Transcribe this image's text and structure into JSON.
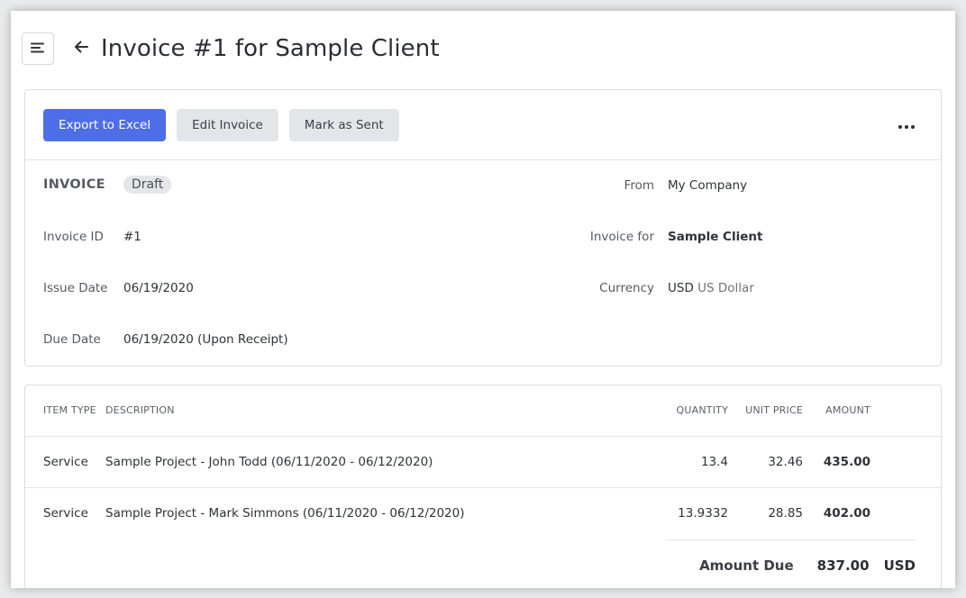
{
  "header": {
    "title": "Invoice #1 for Sample Client"
  },
  "toolbar": {
    "export_label": "Export to Excel",
    "edit_label": "Edit Invoice",
    "mark_sent_label": "Mark as Sent"
  },
  "invoice": {
    "heading": "INVOICE",
    "status": "Draft",
    "id_label": "Invoice ID",
    "id_value": "#1",
    "issue_label": "Issue Date",
    "issue_value": "06/19/2020",
    "due_label": "Due Date",
    "due_value": "06/19/2020 (Upon Receipt)",
    "from_label": "From",
    "from_value": "My Company",
    "for_label": "Invoice for",
    "for_value": "Sample Client",
    "currency_label": "Currency",
    "currency_code": "USD",
    "currency_name": "US Dollar"
  },
  "items_table": {
    "columns": {
      "item_type": "ITEM TYPE",
      "description": "DESCRIPTION",
      "quantity": "QUANTITY",
      "unit_price": "UNIT PRICE",
      "amount": "AMOUNT"
    },
    "rows": [
      {
        "item_type": "Service",
        "description": "Sample Project - John Todd (06/11/2020 - 06/12/2020)",
        "quantity": "13.4",
        "unit_price": "32.46",
        "amount": "435.00"
      },
      {
        "item_type": "Service",
        "description": "Sample Project - Mark Simmons (06/11/2020 - 06/12/2020)",
        "quantity": "13.9332",
        "unit_price": "28.85",
        "amount": "402.00"
      }
    ],
    "total_label": "Amount Due",
    "total_value": "837.00",
    "total_currency": "USD"
  },
  "colors": {
    "primary": "#4e6ee8",
    "secondary_button": "#e3e5e8",
    "badge": "#e4e6e9",
    "border": "#dadce0"
  },
  "icons": {
    "menu": "menu-lines-icon",
    "back": "arrow-left-icon",
    "more": "more-horizontal-icon"
  }
}
